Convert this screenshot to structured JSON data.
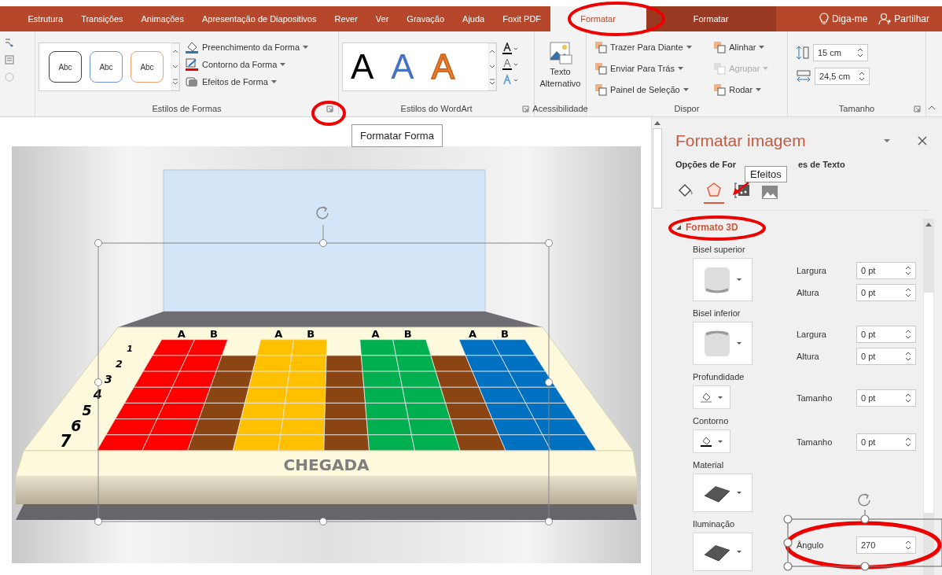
{
  "ribbon_tabs": [
    {
      "label": "Estrutura",
      "selected": false,
      "kind": "tab"
    },
    {
      "label": "Transições",
      "selected": false,
      "kind": "tab"
    },
    {
      "label": "Animações",
      "selected": false,
      "kind": "tab"
    },
    {
      "label": "Apresentação de Diapositivos",
      "selected": false,
      "kind": "tab"
    },
    {
      "label": "Rever",
      "selected": false,
      "kind": "tab"
    },
    {
      "label": "Ver",
      "selected": false,
      "kind": "tab"
    },
    {
      "label": "Gravação",
      "selected": false,
      "kind": "tab"
    },
    {
      "label": "Ajuda",
      "selected": false,
      "kind": "tab"
    },
    {
      "label": "Foxit PDF",
      "selected": false,
      "kind": "tab"
    },
    {
      "label": "Formatar",
      "selected": true,
      "kind": "tab"
    },
    {
      "label": "Formatar",
      "selected": false,
      "kind": "context"
    }
  ],
  "tell_me": "Diga-me",
  "share": "Partilhar",
  "ribbon": {
    "shape_styles": {
      "label": "Estilos de Formas",
      "presets": [
        {
          "text": "Abc",
          "color": "#404040"
        },
        {
          "text": "Abc",
          "color": "#6f94d6"
        },
        {
          "text": "Abc",
          "color": "#f0a070"
        }
      ],
      "commands": [
        "Preenchimento da Forma",
        "Contorno da Forma",
        "Efeitos de Forma"
      ]
    },
    "wordart": {
      "label": "Estilos do WordArt",
      "presets": [
        {
          "text": "A",
          "kind": "solid",
          "color": "#000000"
        },
        {
          "text": "A",
          "kind": "solid",
          "color": "#4472c4"
        },
        {
          "text": "A",
          "kind": "outline",
          "color": "#ed7d31"
        }
      ]
    },
    "accessibility": {
      "label": "Acessibilidade",
      "command": "Texto Alternativo"
    },
    "arrange": {
      "label": "Dispor",
      "commands": [
        {
          "label": "Trazer Para Diante",
          "disabled": false
        },
        {
          "label": "Enviar Para Trás",
          "disabled": false
        },
        {
          "label": "Painel de Seleção",
          "disabled": false
        },
        {
          "label": "Alinhar",
          "disabled": false
        },
        {
          "label": "Agrupar",
          "disabled": true
        },
        {
          "label": "Rodar",
          "disabled": false
        }
      ]
    },
    "size": {
      "label": "Tamanho",
      "height": "15 cm",
      "width": "24,5 cm"
    }
  },
  "screen_tip": "Formatar Forma",
  "slide": {
    "board": {
      "lanes": [
        {
          "kind": "letter",
          "head": "A",
          "color": "#ff0000"
        },
        {
          "kind": "letter",
          "head": "B",
          "color": "#ff0000"
        },
        {
          "kind": "divider",
          "color": "#8b4513"
        },
        {
          "kind": "letter",
          "head": "A",
          "color": "#ffc000"
        },
        {
          "kind": "letter",
          "head": "B",
          "color": "#ffc000"
        },
        {
          "kind": "divider",
          "color": "#8b4513"
        },
        {
          "kind": "letter",
          "head": "A",
          "color": "#00b050"
        },
        {
          "kind": "letter",
          "head": "B",
          "color": "#00b050"
        },
        {
          "kind": "divider",
          "color": "#8b4513"
        },
        {
          "kind": "letter",
          "head": "A",
          "color": "#0070c0"
        },
        {
          "kind": "letter",
          "head": "B",
          "color": "#0070c0"
        }
      ],
      "row_labels": [
        "1",
        "2",
        "3",
        "4",
        "5",
        "6",
        "7"
      ],
      "finish_label": "CHEGADA"
    }
  },
  "panel": {
    "title": "Formatar imagem",
    "tabs": [
      "Opções de For",
      "es de Texto"
    ],
    "tooltip": "Efeitos",
    "icon_tabs": [
      {
        "selected": false
      },
      {
        "selected": true
      },
      {
        "selected": false
      },
      {
        "selected": false
      }
    ],
    "section": {
      "title": "Formato 3D",
      "expanded": true,
      "groups": [
        {
          "label": "Bisel superior",
          "kind": "bevel-top",
          "fields": [
            {
              "label": "Largura",
              "value": "0 pt"
            },
            {
              "label": "Altura",
              "value": "0 pt"
            }
          ]
        },
        {
          "label": "Bisel inferior",
          "kind": "bevel-bottom",
          "fields": [
            {
              "label": "Largura",
              "value": "0 pt"
            },
            {
              "label": "Altura",
              "value": "0 pt"
            }
          ]
        },
        {
          "label": "Profundidade",
          "kind": "color",
          "fields": [
            {
              "label": "Tamanho",
              "value": "0 pt"
            }
          ]
        },
        {
          "label": "Contorno",
          "kind": "color",
          "fields": [
            {
              "label": "Tamanho",
              "value": "0 pt"
            }
          ]
        },
        {
          "label": "Material",
          "kind": "material"
        },
        {
          "label": "Iluminação",
          "kind": "lighting",
          "fields": [
            {
              "label": "Ângulo",
              "value": "270"
            }
          ]
        }
      ]
    }
  }
}
